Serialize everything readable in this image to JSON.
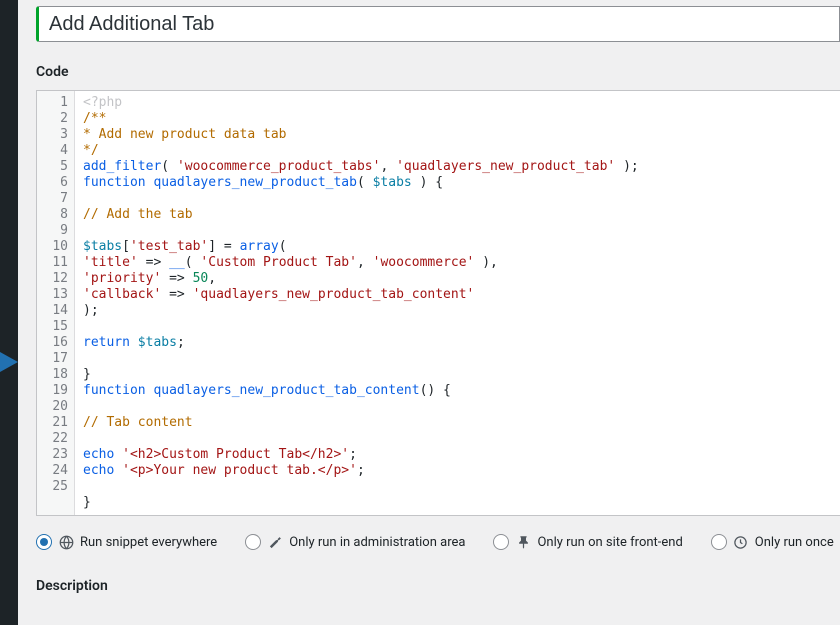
{
  "title": {
    "value": "Add Additional Tab"
  },
  "sections": {
    "code_label": "Code",
    "description_label": "Description"
  },
  "code": {
    "placeholder": "<?php",
    "line_numbers": [
      "",
      "1",
      "2",
      "3",
      "4",
      "5",
      "6",
      "7",
      "8",
      "9",
      "10",
      "11",
      "12",
      "13",
      "14",
      "15",
      "16",
      "17",
      "18",
      "19",
      "20",
      "21",
      "22",
      "23",
      "24",
      "25"
    ],
    "l1": "/**",
    "l2_a": "* ",
    "l2_b": "Add new product data tab",
    "l3": "*/",
    "l4_fn": "add_filter",
    "l4_op1": "( ",
    "l4_s1": "'woocommerce_product_tabs'",
    "l4_c": ", ",
    "l4_s2": "'quadlayers_new_product_tab'",
    "l4_op2": " );",
    "l5_kw": "function",
    "l5_sp": " ",
    "l5_fn": "quadlayers_new_product_tab",
    "l5_op1": "( ",
    "l5_v": "$tabs",
    "l5_op2": " ) {",
    "l6": "",
    "l7": "// Add the tab",
    "l8": "",
    "l9_v": "$tabs",
    "l9_op1": "[",
    "l9_s": "'test_tab'",
    "l9_op2": "] = ",
    "l9_fn": "array",
    "l9_op3": "(",
    "l10_s1": "'title'",
    "l10_op1": " => ",
    "l10_fn": "__",
    "l10_op2": "( ",
    "l10_s2": "'Custom Product Tab'",
    "l10_c": ", ",
    "l10_s3": "'woocommerce'",
    "l10_op3": " ),",
    "l11_s": "'priority'",
    "l11_op1": " => ",
    "l11_n": "50",
    "l11_op2": ",",
    "l12_s1": "'callback'",
    "l12_op": " => ",
    "l12_s2": "'quadlayers_new_product_tab_content'",
    "l13": ");",
    "l14": "",
    "l15_kw": "return",
    "l15_sp": " ",
    "l15_v": "$tabs",
    "l15_op": ";",
    "l16": "",
    "l17": "}",
    "l18_kw": "function",
    "l18_sp": " ",
    "l18_fn": "quadlayers_new_product_tab_content",
    "l18_op": "() {",
    "l19": "",
    "l20": "// Tab content",
    "l21": "",
    "l22_kw": "echo",
    "l22_sp": " ",
    "l22_s": "'<h2>Custom Product Tab</h2>'",
    "l22_op": ";",
    "l23_kw": "echo",
    "l23_sp": " ",
    "l23_s": "'<p>Your new product tab.</p>'",
    "l23_op": ";",
    "l24": "",
    "l25": "}"
  },
  "run_options": {
    "everywhere": "Run snippet everywhere",
    "admin": "Only run in administration area",
    "frontend": "Only run on site front-end",
    "once": "Only run once",
    "selected": "everywhere"
  }
}
